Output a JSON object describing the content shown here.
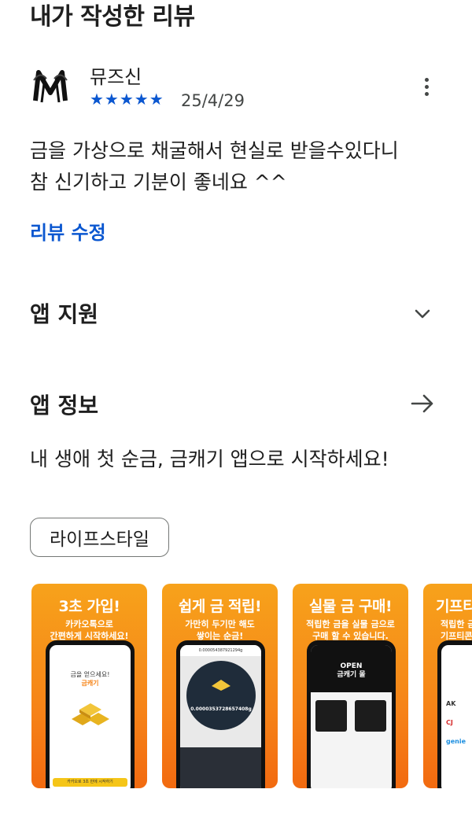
{
  "my_review": {
    "title": "내가 작성한 리뷰",
    "reviewer_name": "뮤즈신",
    "rating": 5,
    "stars": "★★★★★",
    "date": "25/4/29",
    "text_line1": "금을 가상으로 채굴해서 현실로 받을수있다니",
    "text_line2": "참 신기하고 기분이 좋네요 ^^",
    "edit_label": "리뷰 수정"
  },
  "app_support": {
    "title": "앱 지원"
  },
  "app_info": {
    "title": "앱 정보",
    "description": "내 생애 첫 순금, 금캐기 앱으로 시작하세요!"
  },
  "category_chip": "라이프스타일",
  "screenshots": [
    {
      "title": "3초 가입!",
      "subtitle": "카카오톡으로\n간편하게 시작하세요!",
      "screen_text": "금을 얻으세요!",
      "screen_name": "금캐기",
      "screen_button": "카카오로 3초 만에 시작하기"
    },
    {
      "title": "쉽게 금 적립!",
      "subtitle": "가만히 두기만 해도\n쌓이는 순금!",
      "screen_top": "0.000054387921294g",
      "screen_value": "0.0000353728657408g"
    },
    {
      "title": "실물 금 구매!",
      "subtitle": "적립한 금을 실물 금으로\n구매 할 수 있습니다.",
      "screen_open": "OPEN",
      "screen_mall": "금캐기 몰"
    },
    {
      "title": "기프티",
      "subtitle": "적립한 금\n기프티콘",
      "screen_logo1": "AK",
      "screen_logo2": "CJ",
      "screen_logo3": "genie"
    }
  ],
  "colors": {
    "accent_blue": "#0b57d0",
    "star_blue": "#0b57d0",
    "promo_orange": "#f68418"
  }
}
